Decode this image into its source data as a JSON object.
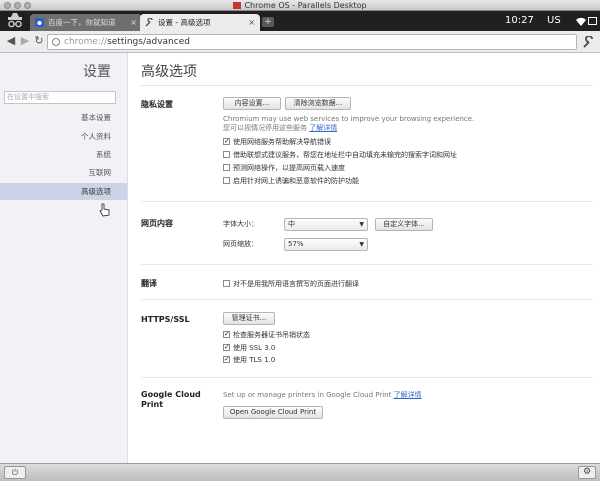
{
  "mac_window": {
    "title": "Chrome OS - Parallels Desktop"
  },
  "tabs": [
    {
      "label": "百度一下，你就知道",
      "active": false
    },
    {
      "label": "设置 - 高级选项",
      "active": true
    }
  ],
  "tray": {
    "clock": "10:27",
    "ime": "US"
  },
  "address_bar": {
    "scheme": "chrome://",
    "path": "settings/advanced"
  },
  "sidebar": {
    "title": "设置",
    "search_placeholder": "在设置中搜索",
    "items": [
      "基本设置",
      "个人资料",
      "系统",
      "互联网",
      "高级选项"
    ],
    "selected_index": 4
  },
  "main": {
    "title": "高级选项",
    "privacy": {
      "title": "隐私设置",
      "content_settings_button": "内容设置...",
      "clear_data_button": "清除浏览数据...",
      "description": "Chromium may use web services to improve your browsing experience.",
      "opt_out_text": "您可以视情况停用这些服务",
      "learn_more": "了解详情",
      "checkboxes": [
        {
          "label": "使用网络服务帮助解决导航错误",
          "checked": true
        },
        {
          "label": "借助联想式建议服务，帮您在地址栏中自动填充未输完的搜索字词和网址",
          "checked": false
        },
        {
          "label": "预测网络操作，以提高网页载入速度",
          "checked": false
        },
        {
          "label": "启用针对网上诱骗和恶意软件的防护功能",
          "checked": false
        }
      ]
    },
    "web_content": {
      "title": "网页内容",
      "font_size_label": "字体大小：",
      "font_size_value": "中",
      "custom_fonts_button": "自定义字体...",
      "zoom_label": "网页缩放：",
      "zoom_value": "57%"
    },
    "translate": {
      "title": "翻译",
      "checkbox_label": "对不是用我所用语言撰写的页面进行翻译",
      "checked": false
    },
    "https": {
      "title": "HTTPS/SSL",
      "manage_certificates_button": "管理证书...",
      "checkboxes": [
        {
          "label": "检查服务器证书吊销状态",
          "checked": true
        },
        {
          "label": "使用 SSL 3.0",
          "checked": true
        },
        {
          "label": "使用 TLS 1.0",
          "checked": true
        }
      ]
    },
    "cloud_print": {
      "title_line1": "Google Cloud",
      "title_line2": "Print",
      "description": "Set up or manage printers in Google Cloud Print",
      "learn_more": "了解详情",
      "open_button": "Open Google Cloud Print"
    }
  },
  "shelf": {
    "power_icon": "power-icon",
    "settings_icon": "gear-icon"
  }
}
